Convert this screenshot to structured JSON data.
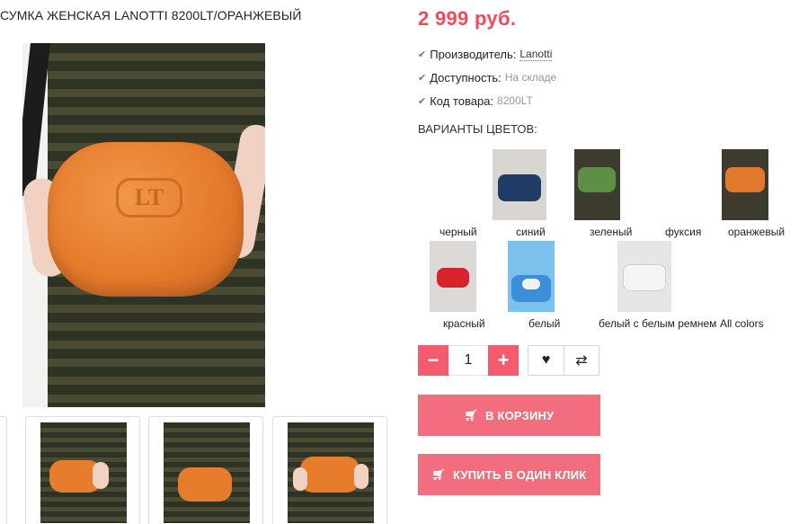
{
  "product": {
    "title": "СУМКА ЖЕНСКАЯ LANOTTI 8200LT/ОРАНЖЕВЫЙ",
    "price": "2 999 руб.",
    "props": [
      {
        "label": "Производитель:",
        "value": "Lanotti",
        "style": "link"
      },
      {
        "label": "Доступность:",
        "value": "На складе",
        "style": "muted"
      },
      {
        "label": "Код товара:",
        "value": "8200LT",
        "style": "muted"
      }
    ],
    "logo_text": "LT"
  },
  "variants": {
    "title": "ВАРИАНТЫ ЦВЕТОВ:",
    "items": [
      {
        "label": "черный"
      },
      {
        "label": "синий",
        "color": "#1f3b66"
      },
      {
        "label": "зеленый",
        "color": "#5d8f44"
      },
      {
        "label": "фуксия"
      },
      {
        "label": "оранжевый",
        "color": "#e2782c"
      },
      {
        "label": "красный",
        "color": "#d8232c"
      },
      {
        "label": "белый",
        "color": "#3a8fd6"
      },
      {
        "label": "белый с белым ремнем",
        "color": "#f4f4f4"
      },
      {
        "label": "All colors"
      }
    ]
  },
  "cart": {
    "quantity": "1",
    "minus_icon": "minus-icon",
    "plus_icon": "plus-icon",
    "wishlist_icon": "heart-icon",
    "compare_icon": "compare-icon",
    "add_to_cart": "В КОРЗИНУ",
    "buy_one_click": "КУПИТЬ В ОДИН КЛИК",
    "cart_icon": "cart-icon"
  },
  "colors": {
    "price": "#f04a5c",
    "button": "#f26e7e",
    "qty_button": "#f45b6c"
  }
}
